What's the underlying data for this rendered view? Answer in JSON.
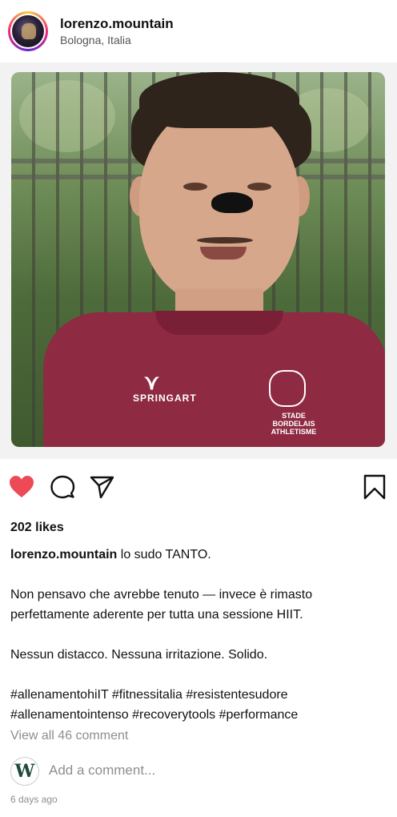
{
  "header": {
    "username": "lorenzo.mountain",
    "location": "Bologna, Italia"
  },
  "post": {
    "shirt_brand": "SPRINGART",
    "shirt_club": "STADE BORDELAIS ATHLETISME",
    "liked": true,
    "like_color": "#ed4956"
  },
  "actions": {
    "like_icon": "heart-icon",
    "comment_icon": "comment-icon",
    "share_icon": "share-icon",
    "save_icon": "bookmark-icon"
  },
  "likes": "202 likes",
  "caption": {
    "username": "lorenzo.mountain",
    "line1": "lo sudo TANTO.",
    "line2": "Non pensavo che avrebbe tenuto — invece è rimasto perfettamente aderente per tutta una sessione HIIT.",
    "line3": "Nessun distacco. Nessuna irritazione. Solido.",
    "hashtags": "#allenamentohiIT #fitnessitalia #resistentesudore #allenamentointenso #recoverytools #performance"
  },
  "comments": {
    "view_all": "View all 46 comment",
    "placeholder": "Add a comment...",
    "avatar_letter": "W"
  },
  "timestamp": "6 days ago"
}
